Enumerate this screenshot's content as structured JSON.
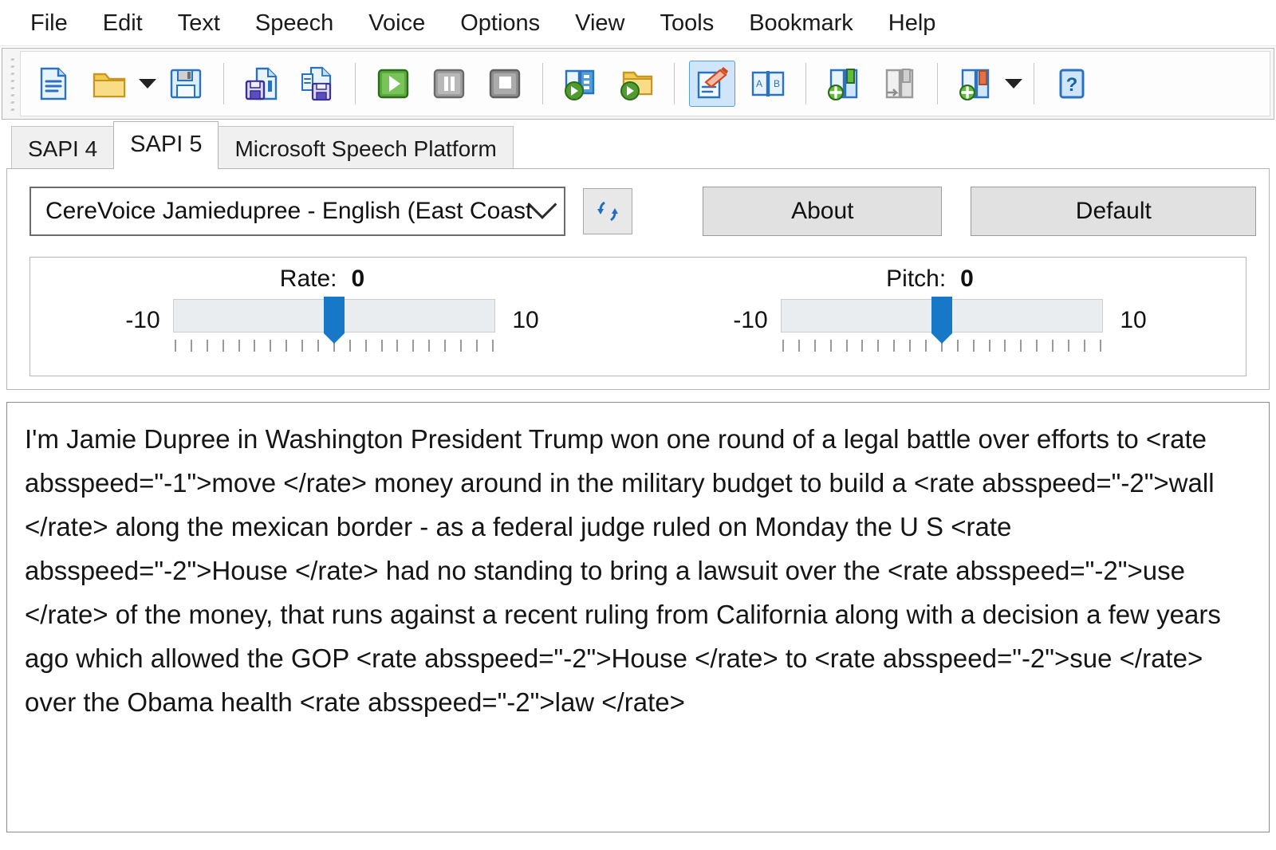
{
  "menubar": {
    "items": [
      {
        "label": "File"
      },
      {
        "label": "Edit"
      },
      {
        "label": "Text"
      },
      {
        "label": "Speech"
      },
      {
        "label": "Voice"
      },
      {
        "label": "Options"
      },
      {
        "label": "View"
      },
      {
        "label": "Tools"
      },
      {
        "label": "Bookmark"
      },
      {
        "label": "Help"
      }
    ]
  },
  "toolbar": {
    "buttons": [
      {
        "name": "new-document-icon"
      },
      {
        "name": "open-folder-icon"
      },
      {
        "name": "open-folder-dropdown-caret-icon"
      },
      {
        "name": "save-floppy-icon"
      },
      {
        "name": "separator"
      },
      {
        "name": "save-audio-icon"
      },
      {
        "name": "save-audio-as-icon"
      },
      {
        "name": "separator"
      },
      {
        "name": "play-icon"
      },
      {
        "name": "pause-icon"
      },
      {
        "name": "stop-icon"
      },
      {
        "name": "separator"
      },
      {
        "name": "play-book-icon"
      },
      {
        "name": "play-folder-icon"
      },
      {
        "name": "separator"
      },
      {
        "name": "edit-pronunciation-icon"
      },
      {
        "name": "abbreviation-book-icon"
      },
      {
        "name": "separator"
      },
      {
        "name": "add-bookmark-icon"
      },
      {
        "name": "goto-bookmark-icon"
      },
      {
        "name": "separator"
      },
      {
        "name": "add-voice-tag-icon"
      },
      {
        "name": "add-voice-tag-caret-icon"
      },
      {
        "name": "separator"
      },
      {
        "name": "help-icon"
      }
    ]
  },
  "tabs": {
    "items": [
      {
        "label": "SAPI 4",
        "selected": false
      },
      {
        "label": "SAPI 5",
        "selected": true
      },
      {
        "label": "Microsoft Speech Platform",
        "selected": false
      }
    ]
  },
  "voice_panel": {
    "voice_combo": {
      "value": "CereVoice Jamiedupree - English (East Coast",
      "icon": "chevron-down-icon"
    },
    "refresh_button": {
      "icon": "refresh-voices-icon"
    },
    "about_button": {
      "label": "About"
    },
    "default_button": {
      "label": "Default"
    },
    "rate": {
      "label": "Rate:",
      "value": "0",
      "min_label": "-10",
      "max_label": "10",
      "min": -10,
      "max": 10,
      "tick_count": 21
    },
    "pitch": {
      "label": "Pitch:",
      "value": "0",
      "min_label": "-10",
      "max_label": "10",
      "min": -10,
      "max": 10,
      "tick_count": 21
    }
  },
  "editor": {
    "content": "I'm Jamie Dupree in Washington President Trump won one round of a legal battle over efforts to <rate absspeed=\"-1\">move </rate> money around in the military budget to build a <rate absspeed=\"-2\">wall </rate> along the mexican border - as a federal judge ruled on Monday the U S <rate absspeed=\"-2\">House </rate> had no standing to bring a lawsuit over the <rate absspeed=\"-2\">use </rate> of the money, that runs against a recent ruling from California along with a decision a few years ago which allowed the GOP <rate absspeed=\"-2\">House </rate> to <rate absspeed=\"-2\">sue </rate> over the Obama health <rate absspeed=\"-2\">law </rate>"
  },
  "colors": {
    "accent_blue": "#1878c8",
    "toolbar_active": "#cfe6fa",
    "button_face": "#e1e1e1",
    "track": "#e9edef"
  }
}
